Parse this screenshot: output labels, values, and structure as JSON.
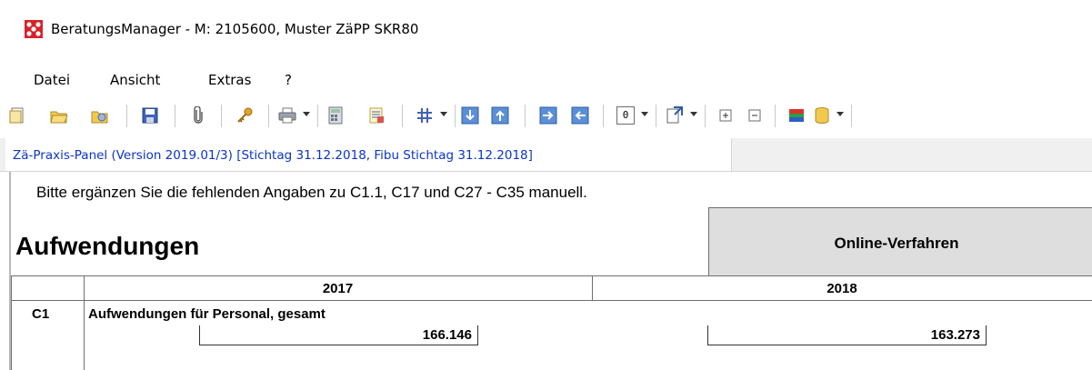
{
  "window": {
    "title": "BeratungsManager - M: 2105600, Muster ZäPP SKR80"
  },
  "menu": {
    "items": [
      {
        "label": "Datei"
      },
      {
        "label": "Ansicht"
      },
      {
        "label": "Extras"
      },
      {
        "label": "?"
      }
    ]
  },
  "toolbar": {
    "buttons": [
      {
        "icon": "new-icon"
      },
      {
        "icon": "open-folder-icon"
      },
      {
        "icon": "open-multiple-icon"
      },
      {
        "icon": "save-icon"
      },
      {
        "icon": "attachment-icon"
      },
      {
        "icon": "key-icon"
      },
      {
        "icon": "print-icon"
      },
      {
        "icon": "calculator-icon"
      },
      {
        "icon": "notes-icon"
      },
      {
        "icon": "grid-icon"
      },
      {
        "icon": "move-down-icon"
      },
      {
        "icon": "move-up-icon"
      },
      {
        "icon": "move-right-icon"
      },
      {
        "icon": "move-left-icon"
      },
      {
        "icon": "zero-value-icon"
      },
      {
        "icon": "export-icon"
      },
      {
        "icon": "expand-icon"
      },
      {
        "icon": "collapse-icon"
      },
      {
        "icon": "color-icon"
      },
      {
        "icon": "database-icon"
      }
    ],
    "zero_label": "0"
  },
  "tab": {
    "label": "Zä-Praxis-Panel (Version 2019.01/3) [Stichtag 31.12.2018, Fibu Stichtag 31.12.2018]"
  },
  "content": {
    "info_text": "Bitte ergänzen Sie die fehlenden Angaben zu C1.1, C17 und C27 - C35 manuell.",
    "heading": "Aufwendungen",
    "online_label": "Online-Verfahren",
    "table": {
      "year_headers": [
        "2017",
        "2018"
      ],
      "rows": [
        {
          "code": "C1",
          "label": "Aufwendungen für Personal, gesamt",
          "value_2017": "166.146",
          "value_2018": "163.273"
        }
      ]
    }
  },
  "colors": {
    "tab_text": "#0a35c9",
    "online_box": "#dedede"
  }
}
